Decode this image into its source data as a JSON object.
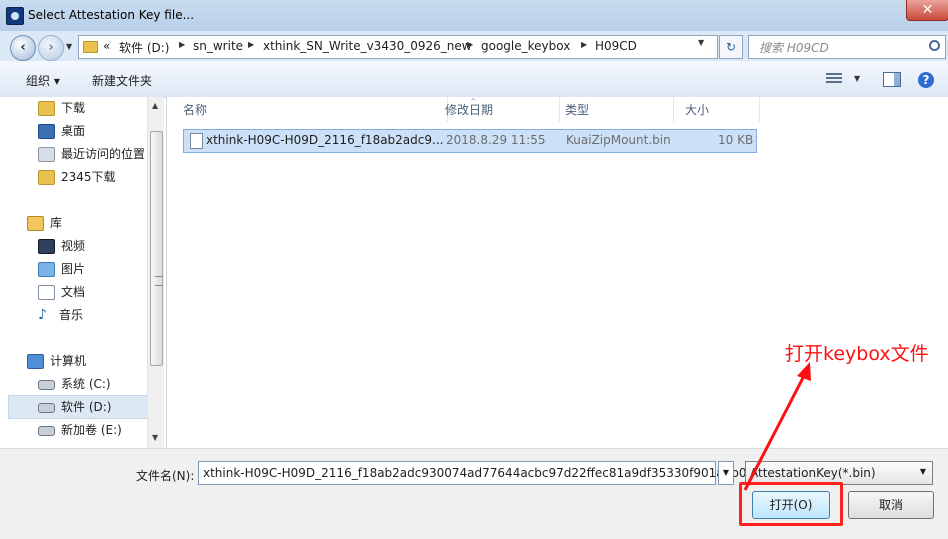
{
  "window": {
    "title": "Select Attestation Key file...",
    "close_label": "✕"
  },
  "address": {
    "overflow": "«",
    "crumbs": [
      "软件 (D:)",
      "sn_write",
      "xthink_SN_Write_v3430_0926_new",
      "google_keybox",
      "H09CD"
    ]
  },
  "search": {
    "placeholder": "搜索 H09CD"
  },
  "toolbar": {
    "organize": "组织 ▾",
    "new_folder": "新建文件夹"
  },
  "nav": {
    "items": [
      "下载",
      "桌面",
      "最近访问的位置",
      "2345下载",
      "库",
      "视频",
      "图片",
      "文档",
      "音乐",
      "计算机",
      "系统 (C:)",
      "软件 (D:)",
      "新加卷 (E:)"
    ]
  },
  "columns": {
    "name": "名称",
    "date": "修改日期",
    "type": "类型",
    "size": "大小"
  },
  "files": [
    {
      "name": "xthink-H09C-H09D_2116_f18ab2adc9...",
      "date": "2018.8.29 11:55",
      "type": "KuaiZipMount.bin",
      "size": "10 KB"
    }
  ],
  "footer": {
    "filename_label": "文件名(N):",
    "filename_value": "xthink-H09C-H09D_2116_f18ab2adc930074ad77644acbc97d22ffec81a9df35330f901a4b0",
    "filter": "AttestationKey(*.bin)",
    "open": "打开(O)",
    "cancel": "取消"
  },
  "annotation": {
    "text": "打开keybox文件",
    "color": "#ff1010"
  }
}
